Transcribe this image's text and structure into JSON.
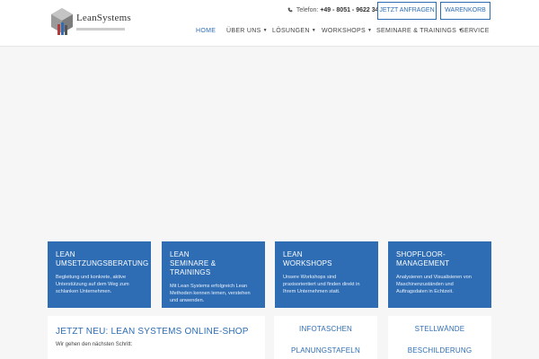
{
  "header": {
    "logo_text": "LeanSystems",
    "phone_label": "Telefon:",
    "phone_number": "+49 - 8051 - 9622 344",
    "btn_anfragen": "JETZT ANFRAGEN",
    "btn_warenkorb": "WARENKORB"
  },
  "nav": {
    "items": [
      {
        "label": "HOME"
      },
      {
        "label": "ÜBER UNS"
      },
      {
        "label": "LÖSUNGEN"
      },
      {
        "label": "WORKSHOPS"
      },
      {
        "label": "SEMINARE & TRAININGS"
      },
      {
        "label": "SERVICE"
      }
    ]
  },
  "cards": [
    {
      "title_1": "LEAN",
      "title_2": "UMSETZUNGSBERATUNG",
      "text": "Begleitung und konkrete, aktive Unterstützung auf dem Weg zum schlanken Unternehmen."
    },
    {
      "title_1": "LEAN",
      "title_2": "SEMINARE & TRAININGS",
      "text": "Mit Lean Systems erfolgreich Lean Methoden kennen lernen, verstehen und anwenden."
    },
    {
      "title_1": "LEAN",
      "title_2": "WORKSHOPS",
      "text": "Unsere Workshops sind praxisorientiert und finden direkt in Ihrem Unternehmen statt."
    },
    {
      "title_1": "SHOPFLOOR-",
      "title_2": "MANAGEMENT",
      "text": "Analysieren und Visualisieren von Maschinenzuständen und Auftragsdaten in Echtzeit."
    }
  ],
  "shop": {
    "title": "JETZT NEU: LEAN SYSTEMS ONLINE-SHOP",
    "text": "Wir gehen den nächsten Schritt:"
  },
  "links": {
    "box_a": [
      "INFOTASCHEN",
      "PLANUNGSTAFELN"
    ],
    "box_b": [
      "STELLWÄNDE",
      "BESCHILDERUNG"
    ]
  },
  "colors": {
    "accent": "#2e6db4",
    "page_bg": "#f6f6f6"
  }
}
